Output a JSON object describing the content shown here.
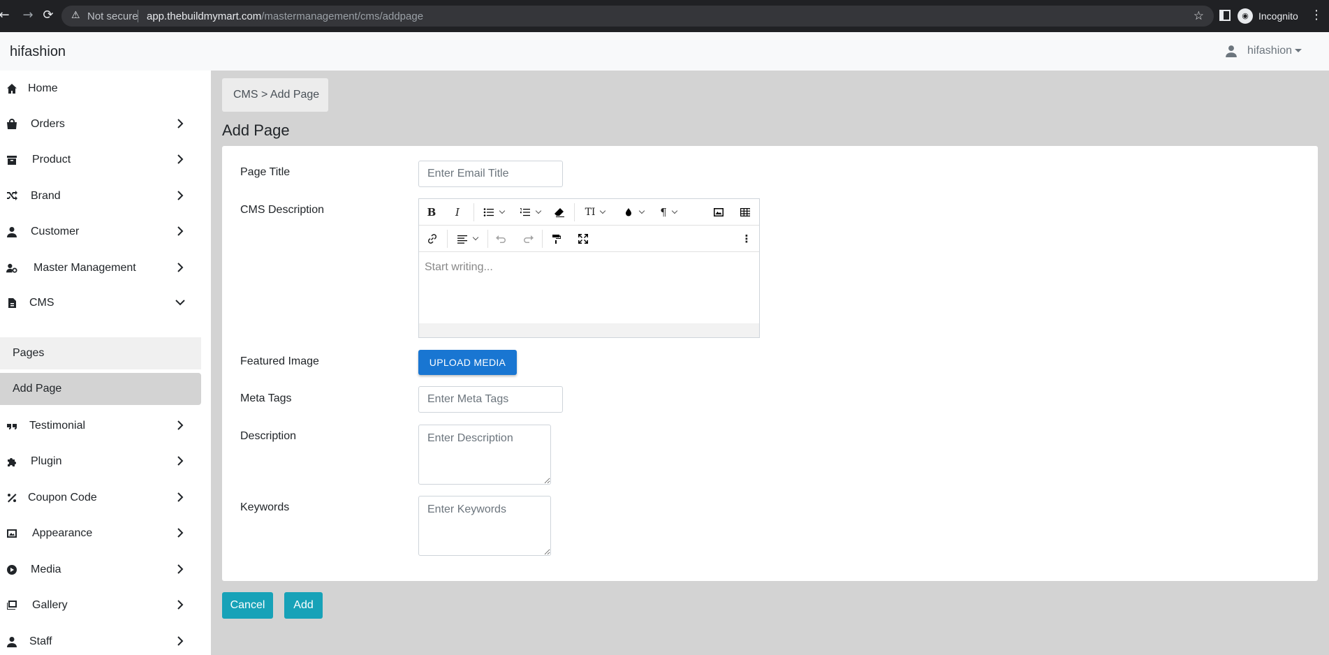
{
  "browser": {
    "not_secure": "Not secure",
    "url_host": "app.thebuildmymart.com",
    "url_path": "/mastermanagement/cms/addpage",
    "incognito": "Incognito"
  },
  "navbar": {
    "brand": "hifashion",
    "user": "hifashion"
  },
  "sidebar": {
    "items": [
      {
        "label": "Home",
        "icon": "home-icon"
      },
      {
        "label": "Orders",
        "icon": "shopping-bag-icon"
      },
      {
        "label": "Product",
        "icon": "archive-box-icon"
      },
      {
        "label": "Brand",
        "icon": "shuffle-icon"
      },
      {
        "label": "Customer",
        "icon": "user-icon"
      },
      {
        "label": "Master Management",
        "icon": "user-gear-icon"
      },
      {
        "label": "CMS",
        "icon": "file-icon"
      },
      {
        "label": "Testimonial",
        "icon": "quote-icon"
      },
      {
        "label": "Plugin",
        "icon": "puzzle-icon"
      },
      {
        "label": "Coupon Code",
        "icon": "percent-icon"
      },
      {
        "label": "Appearance",
        "icon": "image-icon"
      },
      {
        "label": "Media",
        "icon": "play-circle-icon"
      },
      {
        "label": "Gallery",
        "icon": "images-icon"
      },
      {
        "label": "Staff",
        "icon": "user-icon"
      }
    ],
    "cms_sub": [
      {
        "label": "Pages"
      },
      {
        "label": "Add Page"
      }
    ]
  },
  "main": {
    "breadcrumb": "CMS > Add Page",
    "title": "Add Page",
    "form": {
      "page_title_label": "Page Title",
      "page_title_placeholder": "Enter Email Title",
      "cms_description_label": "CMS Description",
      "editor_placeholder": "Start writing...",
      "featured_image_label": "Featured Image",
      "upload_label": "UPLOAD MEDIA",
      "meta_tags_label": "Meta Tags",
      "meta_tags_placeholder": "Enter Meta Tags",
      "description_label": "Description",
      "description_placeholder": "Enter Description",
      "keywords_label": "Keywords",
      "keywords_placeholder": "Enter Keywords"
    },
    "cancel_label": "Cancel",
    "add_label": "Add"
  },
  "colors": {
    "primary": "#1976d2",
    "action": "#17a2b8",
    "background": "#d3d3d3"
  }
}
